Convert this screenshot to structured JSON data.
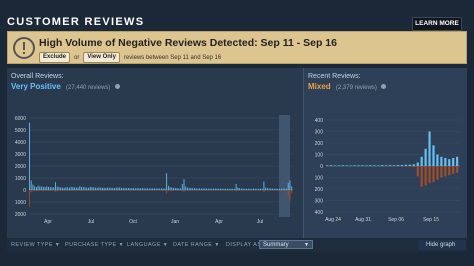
{
  "header": {
    "title": "CUSTOMER REVIEWS",
    "learn_more": "LEARN MORE"
  },
  "alert": {
    "title": "High Volume of Negative Reviews Detected: Sep 11 - Sep 16",
    "exclude_label": "Exclude",
    "or_text": "or",
    "view_only_label": "View Only",
    "description": "reviews between Sep 11 and Sep 16"
  },
  "overall": {
    "label": "Overall Reviews:",
    "rating": "Very Positive",
    "count": "(27,440 reviews)",
    "rating_color": "#66c0f4"
  },
  "recent": {
    "label": "Recent Reviews:",
    "rating": "Mixed",
    "count": "(2,379 reviews)",
    "rating_color": "#e5a14a"
  },
  "filters": {
    "review_type": "REVIEW TYPE",
    "purchase_type": "PURCHASE TYPE",
    "language": "LANGUAGE",
    "date_range": "DATE RANGE",
    "display_as_label": "DISPLAY AS:",
    "display_as_value": "Summary",
    "hide_graph": "Hide graph"
  },
  "chart_data": [
    {
      "type": "bar",
      "title": "Overall Reviews",
      "y_ticks": [
        "6000",
        "5000",
        "4000",
        "3000",
        "2000",
        "1000",
        "0",
        "1000",
        "2000"
      ],
      "x_ticks": [
        "Apr",
        "Jul",
        "Oct",
        "Jan",
        "Apr",
        "Jul"
      ],
      "ylim": [
        -2000,
        6000
      ],
      "positive": [
        5600,
        800,
        450,
        300,
        250,
        350,
        300,
        280,
        260,
        240,
        300,
        260,
        240,
        220,
        250,
        650,
        280,
        240,
        220,
        200,
        180,
        240,
        220,
        200,
        260,
        240,
        220,
        210,
        200,
        300,
        260,
        240,
        220,
        200,
        190,
        260,
        240,
        220,
        200,
        180,
        220,
        200,
        190,
        180,
        170,
        200,
        190,
        180,
        170,
        160,
        200,
        220,
        200,
        180,
        160,
        160,
        170,
        160,
        150,
        160,
        150,
        140,
        160,
        150,
        140,
        150,
        140,
        130,
        140,
        130,
        130,
        140,
        130,
        120,
        130,
        120,
        130,
        120,
        120,
        1400,
        350,
        250,
        200,
        180,
        160,
        150,
        140,
        130,
        500,
        900,
        300,
        200,
        180,
        160,
        150,
        140,
        130,
        120,
        130,
        120,
        120,
        130,
        120,
        110,
        120,
        110,
        110,
        120,
        110,
        100,
        110,
        100,
        100,
        110,
        100,
        100,
        110,
        100,
        100,
        500,
        200,
        140,
        120,
        110,
        100,
        100,
        110,
        100,
        100,
        120,
        110,
        100,
        100,
        110,
        100,
        700,
        200,
        150,
        130,
        120,
        110,
        100,
        110,
        100,
        100,
        100,
        110,
        100,
        100,
        600,
        800,
        300
      ],
      "negative": [
        1400,
        200,
        120,
        100,
        90,
        100,
        90,
        80,
        80,
        70,
        90,
        80,
        70,
        70,
        70,
        150,
        80,
        70,
        70,
        60,
        60,
        70,
        70,
        60,
        70,
        70,
        60,
        60,
        60,
        80,
        70,
        70,
        60,
        60,
        60,
        70,
        70,
        60,
        60,
        60,
        60,
        60,
        60,
        60,
        50,
        60,
        60,
        50,
        50,
        50,
        60,
        60,
        60,
        50,
        50,
        50,
        50,
        50,
        50,
        50,
        50,
        50,
        50,
        50,
        50,
        50,
        50,
        50,
        50,
        50,
        50,
        50,
        50,
        40,
        40,
        40,
        40,
        40,
        40,
        300,
        100,
        80,
        60,
        50,
        50,
        50,
        50,
        40,
        120,
        200,
        80,
        60,
        50,
        50,
        50,
        40,
        40,
        40,
        40,
        40,
        40,
        40,
        40,
        40,
        40,
        40,
        40,
        40,
        40,
        40,
        40,
        40,
        40,
        40,
        40,
        40,
        40,
        40,
        40,
        120,
        60,
        50,
        40,
        40,
        40,
        40,
        40,
        40,
        40,
        40,
        40,
        40,
        40,
        40,
        40,
        180,
        60,
        50,
        40,
        40,
        40,
        40,
        40,
        40,
        40,
        40,
        40,
        40,
        40,
        500,
        900,
        300
      ]
    },
    {
      "type": "bar",
      "title": "Recent Reviews",
      "y_ticks": [
        "400",
        "300",
        "200",
        "100",
        "0",
        "100",
        "200",
        "300",
        "400"
      ],
      "x_ticks": [
        "Aug 24",
        "Aug 31",
        "Sep 06",
        "Sep 15"
      ],
      "ylim": [
        -400,
        400
      ],
      "positive": [
        5,
        6,
        4,
        5,
        6,
        5,
        4,
        6,
        5,
        6,
        5,
        7,
        6,
        5,
        8,
        6,
        7,
        6,
        8,
        9,
        10,
        12,
        15,
        30,
        80,
        150,
        300,
        180,
        100,
        80,
        70,
        60,
        70,
        80
      ],
      "negative": [
        0,
        0,
        0,
        0,
        0,
        0,
        0,
        0,
        0,
        0,
        0,
        0,
        0,
        0,
        0,
        0,
        0,
        0,
        2,
        4,
        3,
        5,
        10,
        90,
        180,
        170,
        150,
        140,
        120,
        100,
        90,
        80,
        70,
        60
      ]
    }
  ]
}
